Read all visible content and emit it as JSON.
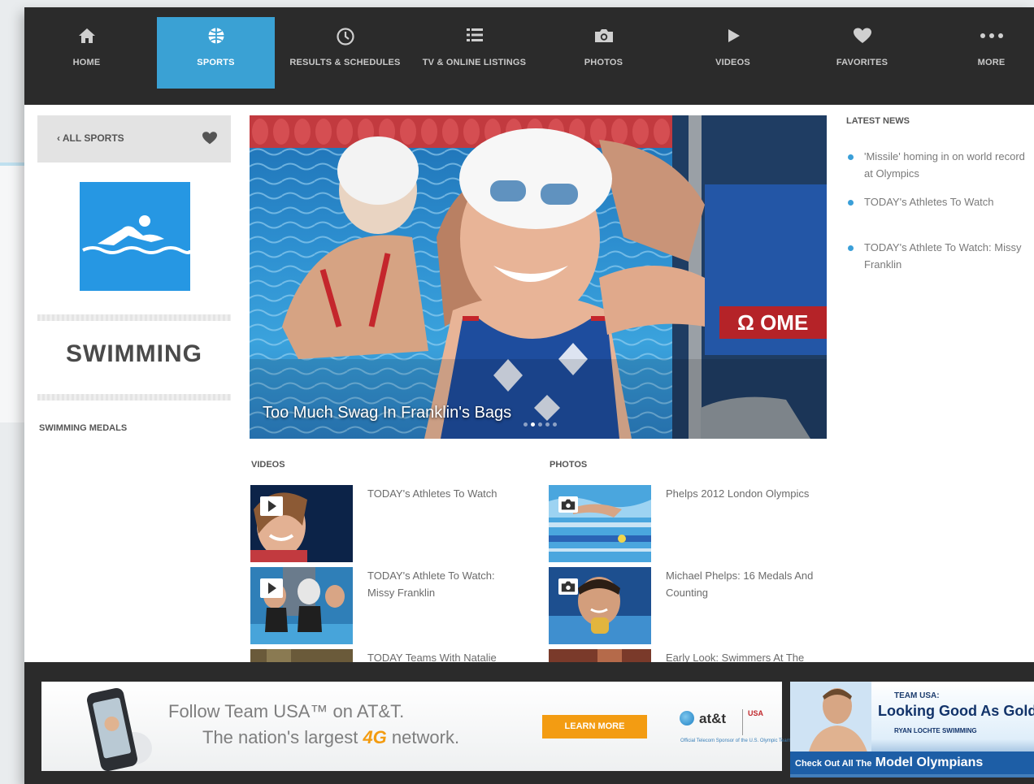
{
  "nav": {
    "items": [
      {
        "label": "HOME",
        "icon": "home-icon"
      },
      {
        "label": "SPORTS",
        "icon": "globe-icon",
        "active": true
      },
      {
        "label": "RESULTS & SCHEDULES",
        "icon": "clock-icon"
      },
      {
        "label": "TV & ONLINE LISTINGS",
        "icon": "list-icon"
      },
      {
        "label": "PHOTOS",
        "icon": "camera-icon"
      },
      {
        "label": "VIDEOS",
        "icon": "play-icon"
      },
      {
        "label": "FAVORITES",
        "icon": "heart-icon"
      },
      {
        "label": "MORE",
        "icon": "more-icon"
      }
    ]
  },
  "sidebar": {
    "back_label": "ALL SPORTS",
    "sport_icon": "swimming-icon",
    "sport_name": "SWIMMING",
    "medals_link": "SWIMMING MEDALS"
  },
  "hero": {
    "caption": "Too Much Swag In Franklin's Bags",
    "slide_count": 5,
    "active_slide": 2
  },
  "videos": {
    "heading": "VIDEOS",
    "items": [
      {
        "title": "TODAY's Athletes To Watch"
      },
      {
        "title": "TODAY's Athlete To Watch: Missy Franklin"
      },
      {
        "title": "TODAY Teams With Natalie"
      }
    ]
  },
  "photos": {
    "heading": "PHOTOS",
    "items": [
      {
        "title": "Phelps 2012 London Olympics"
      },
      {
        "title": "Michael Phelps: 16 Medals And Counting"
      },
      {
        "title": "Early Look: Swimmers At The"
      }
    ]
  },
  "news": {
    "heading": "LATEST NEWS",
    "items": [
      {
        "title": "'Missile' homing in on world record at Olympics"
      },
      {
        "title": "TODAY's Athletes To Watch"
      },
      {
        "title": "TODAY's Athlete To Watch: Missy Franklin"
      }
    ]
  },
  "ads": {
    "att": {
      "line1": "Follow Team USA™ on AT&T.",
      "line2_pre": "The nation's largest",
      "line2_4g": "4G",
      "line2_post": "network.",
      "button": "LEARN MORE",
      "logo": "at&t",
      "badge": "USA",
      "tagline": "Official Telecom Sponsor of the U.S. Olympic Team"
    },
    "lochte": {
      "team": "TEAM USA:",
      "headline": "Looking Good As Gold",
      "sub": "RYAN LOCHTE SWIMMING",
      "cta_small": "Check Out All The",
      "cta_big": "Model Olympians"
    }
  },
  "colors": {
    "accent": "#3aa1d4",
    "nav_bg": "#2b2b2b",
    "sport_tile": "#2697e3",
    "ad_button": "#f39c12"
  }
}
